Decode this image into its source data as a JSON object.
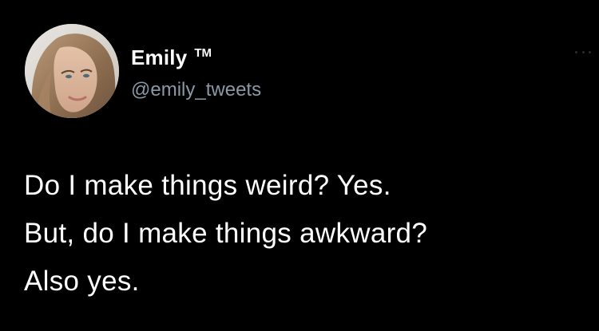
{
  "tweet": {
    "author": {
      "display_name": "Emily",
      "name_suffix": "TM",
      "handle": "@emily_tweets",
      "avatar_icon": "profile-photo"
    },
    "more_icon": "more-options-icon",
    "text_lines": [
      "Do I make things weird? Yes.",
      "But, do I make things awkward?",
      "Also yes."
    ],
    "colors": {
      "background": "#000000",
      "text": "#ffffff",
      "handle": "#8b98a5"
    }
  }
}
